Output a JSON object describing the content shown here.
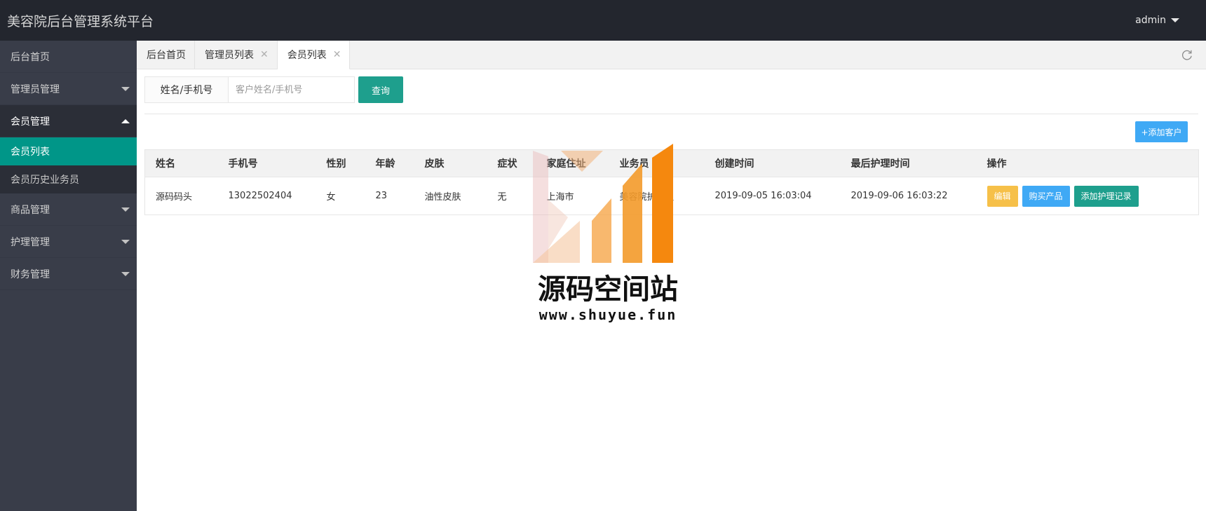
{
  "header": {
    "title": "美容院后台管理系统平台",
    "user": "admin"
  },
  "sidebar": {
    "items": [
      {
        "label": "后台首页"
      },
      {
        "label": "管理员管理"
      },
      {
        "label": "会员管理",
        "children": [
          {
            "label": "会员列表",
            "active": true
          },
          {
            "label": "会员历史业务员"
          }
        ]
      },
      {
        "label": "商品管理"
      },
      {
        "label": "护理管理"
      },
      {
        "label": "财务管理"
      }
    ]
  },
  "tabs": [
    {
      "label": "后台首页"
    },
    {
      "label": "管理员列表"
    },
    {
      "label": "会员列表",
      "active": true
    }
  ],
  "search": {
    "label": "姓名/手机号",
    "placeholder": "客户姓名/手机号",
    "button": "查询"
  },
  "toolbar": {
    "add_button": "+添加客户"
  },
  "table": {
    "columns": [
      "姓名",
      "手机号",
      "性别",
      "年龄",
      "皮肤",
      "症状",
      "家庭住址",
      "业务员",
      "创建时间",
      "最后护理时间",
      "操作"
    ],
    "rows": [
      {
        "name": "源码码头",
        "phone": "13022502404",
        "gender": "女",
        "age": "23",
        "skin": "油性皮肤",
        "symptom": "无",
        "address": "上海市",
        "salesman": "美容院护理员",
        "created": "2019-09-05 16:03:04",
        "last_care": "2019-09-06 16:03:22",
        "actions": {
          "edit": "编辑",
          "buy": "购买产品",
          "care": "添加护理记录"
        }
      }
    ]
  },
  "watermark": {
    "title": "源码空间站",
    "url": "www.shuyue.fun"
  },
  "colors": {
    "header_bg": "#23262e",
    "sidebar_bg": "#393d49",
    "accent_green": "#009688",
    "button_teal": "#1e9f8d",
    "button_blue": "#3fa9f5",
    "button_yellow": "#f6c049"
  }
}
